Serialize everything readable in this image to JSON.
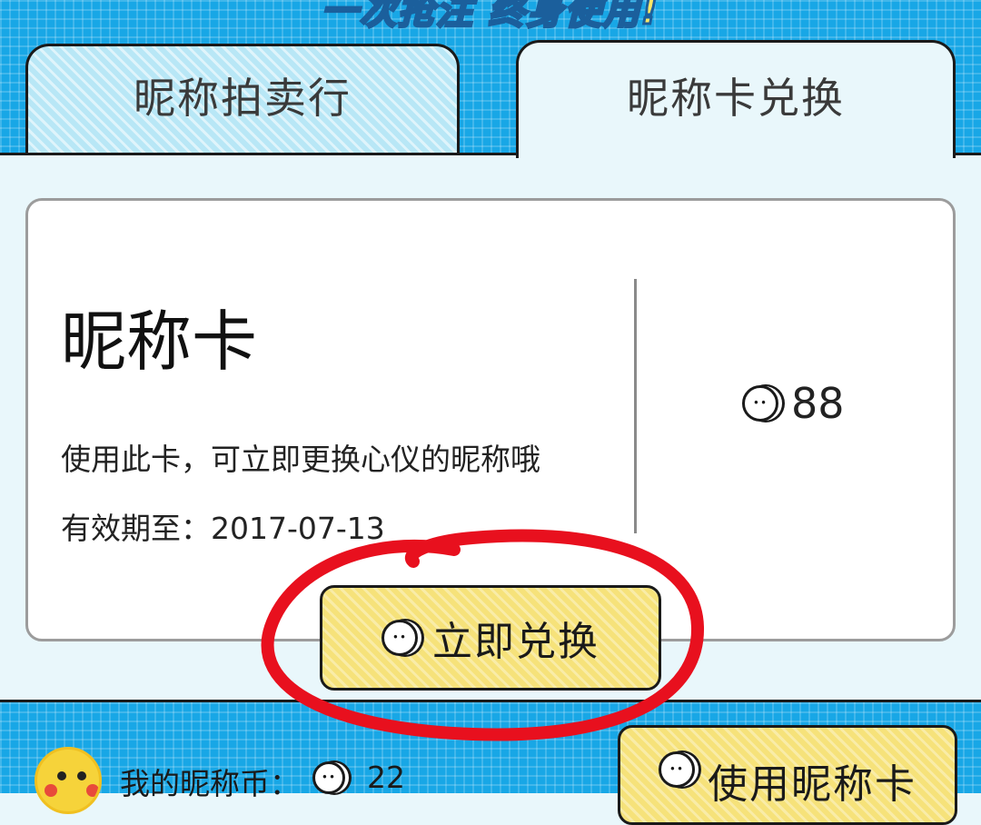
{
  "header": {
    "banner": "一次抢注 终身使用!"
  },
  "tabs": [
    {
      "label": "昵称拍卖行",
      "active": false
    },
    {
      "label": "昵称卡兑换",
      "active": true
    }
  ],
  "card": {
    "title": "昵称卡",
    "description": "使用此卡，可立即更换心仪的昵称哦",
    "expiry": "有效期至：2017-07-13",
    "price": "88",
    "price_icon": "coin-icon"
  },
  "redeem_button": {
    "label": "立即兑换",
    "icon": "coin-icon"
  },
  "footer": {
    "avatar": "pikachu-avatar",
    "coins_label": "我的昵称币：",
    "coins_value": "22",
    "use_card_label": "使用昵称卡"
  },
  "colors": {
    "header_blue": "#18a7e6",
    "button_yellow": "#f6e27a",
    "annotation_red": "#e8101e",
    "panel_bg": "#e9f7fb"
  }
}
